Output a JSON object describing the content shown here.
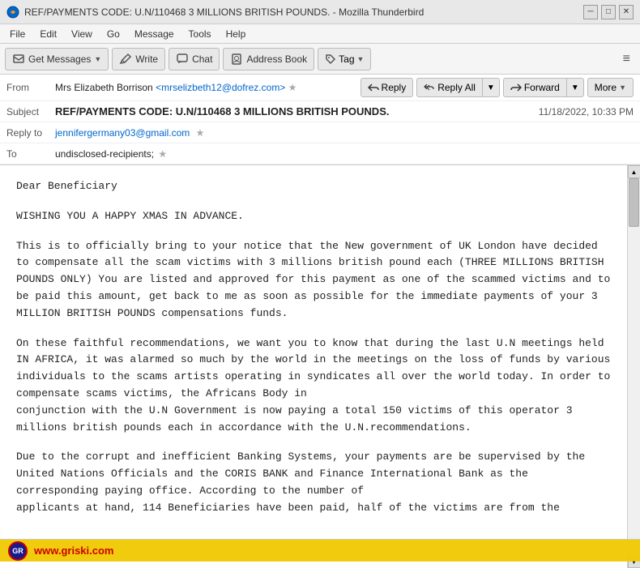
{
  "window": {
    "title": "REF/PAYMENTS CODE: U.N/110468 3 MILLIONS BRITISH POUNDS. - Mozilla Thunderbird",
    "icon": "thunderbird"
  },
  "titlebar": {
    "minimize_label": "─",
    "maximize_label": "□",
    "close_label": "✕"
  },
  "menu": {
    "items": [
      "File",
      "Edit",
      "View",
      "Go",
      "Message",
      "Tools",
      "Help"
    ]
  },
  "toolbar": {
    "get_messages_label": "Get Messages",
    "write_label": "Write",
    "chat_label": "Chat",
    "address_book_label": "Address Book",
    "tag_label": "Tag",
    "menu_icon": "≡"
  },
  "email": {
    "from_label": "From",
    "from_name": "Mrs Elizabeth Borrison",
    "from_email": "<mrselizbeth12@dofrez.com>",
    "subject_label": "Subject",
    "subject": "REF/PAYMENTS CODE: U.N/110468 3 MILLIONS BRITISH POUNDS.",
    "reply_to_label": "Reply to",
    "reply_to": "jennifergermany03@gmail.com",
    "to_label": "To",
    "to": "undisclosed-recipients;",
    "date": "11/18/2022, 10:33 PM",
    "reply_label": "Reply",
    "reply_all_label": "Reply All",
    "forward_label": "Forward",
    "more_label": "More"
  },
  "body": {
    "paragraph1": "Dear Beneficiary",
    "paragraph2": "WISHING YOU A HAPPY XMAS IN ADVANCE.",
    "paragraph3": "This is to officially bring to your notice that the New government of UK London have decided to compensate all the scam victims with 3 millions british pound each (THREE MILLIONS BRITISH POUNDS ONLY) You are listed and approved for this payment as one of the scammed victims and to be paid this amount, get back to me as soon as possible for the immediate payments of your 3 MILLION BRITISH POUNDS compensations funds.",
    "paragraph4": "On these faithful recommendations, we want you to know that during the last U.N meetings held IN AFRICA, it was alarmed so much by the world in the meetings on the loss of funds by various individuals to the scams artists operating in syndicates all over the world today. In order to compensate scams victims, the Africans Body in\nconjunction with the U.N Government is now paying a total 150 victims of this operator 3 millions british pounds each in accordance with the U.N.recommendations.",
    "paragraph5": "Due to the corrupt and inefficient Banking Systems, your payments are be supervised by the United Nations Officials and the CORIS BANK and Finance International Bank as the corresponding paying office. According to the number of\napplicants at hand, 114 Beneficiaries have been paid, half of the victims are from the"
  },
  "watermark": {
    "text": "www.griski.com",
    "logo_text": "GR"
  }
}
